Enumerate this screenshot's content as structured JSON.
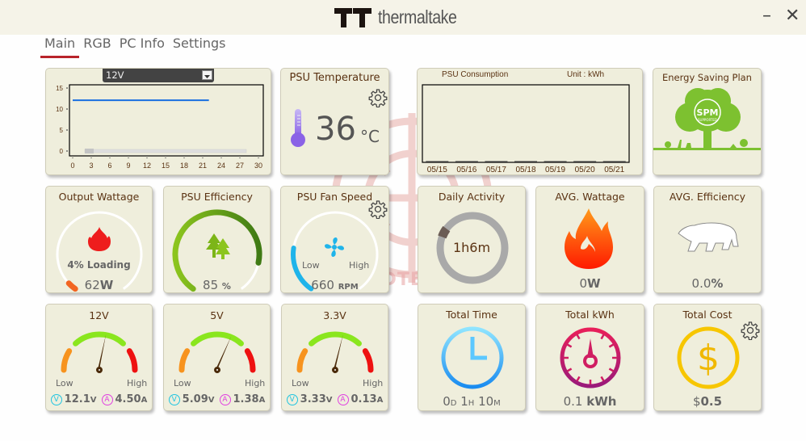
{
  "app": {
    "brand": "thermaltake",
    "minimize_label": "–",
    "close_label": "✕"
  },
  "tabs": [
    {
      "label": "Main",
      "active": true
    },
    {
      "label": "RGB",
      "active": false
    },
    {
      "label": "PC Info",
      "active": false
    },
    {
      "label": "Settings",
      "active": false
    }
  ],
  "voltage_chart": {
    "selected_rail": "12V",
    "chart_data": {
      "type": "line",
      "title": "",
      "xlabel": "",
      "ylabel": "",
      "x_ticks": [
        "0",
        "3",
        "6",
        "9",
        "12",
        "15",
        "18",
        "21",
        "24",
        "27",
        "30"
      ],
      "y_ticks": [
        "0",
        "5",
        "10",
        "15"
      ],
      "xlim": [
        0,
        30
      ],
      "ylim": [
        0,
        15
      ],
      "series": [
        {
          "name": "12V",
          "x": [
            0,
            22
          ],
          "y": [
            12.1,
            12.1
          ],
          "color": "#1a6fe0"
        }
      ]
    },
    "scrollbar_position": 0
  },
  "psu_temperature": {
    "title": "PSU Temperature",
    "value": "36",
    "unit": "°C"
  },
  "psu_consumption": {
    "title": "PSU Consumption",
    "unit_label": "Unit : kWh",
    "chart_data": {
      "type": "bar",
      "categories": [
        "05/15",
        "05/16",
        "05/17",
        "05/18",
        "05/19",
        "05/20",
        "05/21"
      ],
      "values": [
        0,
        0,
        0,
        0,
        0,
        0,
        0
      ],
      "ylabel": "kWh"
    }
  },
  "energy_saving": {
    "title": "Energy Saving Plan",
    "badge_main": "SPM",
    "badge_sub": "SUPPORTED"
  },
  "output_wattage": {
    "title": "Output Wattage",
    "loading": "4% Loading",
    "loading_fraction": 0.04,
    "value": "62",
    "unit": "W"
  },
  "psu_efficiency": {
    "title": "PSU Efficiency",
    "value": "85",
    "unit": "%",
    "fraction": 0.85
  },
  "fan_speed": {
    "title": "PSU Fan Speed",
    "low_label": "Low",
    "high_label": "High",
    "value": "660",
    "unit": "RPM",
    "fraction": 0.22
  },
  "daily_activity": {
    "title": "Daily Activity",
    "value": "1h6m",
    "fraction": 0.046
  },
  "avg_wattage": {
    "title": "AVG. Wattage",
    "value": "0",
    "unit": "W"
  },
  "avg_efficiency": {
    "title": "AVG. Efficiency",
    "value": "0.0",
    "unit": "%"
  },
  "rails": [
    {
      "title": "12V",
      "low": "Low",
      "high": "High",
      "volts": "12.1",
      "volts_unit": "V",
      "amps": "4.50",
      "amps_unit": "A",
      "needle_deg": 8
    },
    {
      "title": "5V",
      "low": "Low",
      "high": "High",
      "volts": "5.09",
      "volts_unit": "V",
      "amps": "1.38",
      "amps_unit": "A",
      "needle_deg": 20
    },
    {
      "title": "3.3V",
      "low": "Low",
      "high": "High",
      "volts": "3.33",
      "volts_unit": "V",
      "amps": "0.13",
      "amps_unit": "A",
      "needle_deg": 10
    }
  ],
  "volt_icon": "V",
  "amp_icon": "A",
  "total_time": {
    "title": "Total Time",
    "d": "0",
    "d_unit": "D",
    "h": "1",
    "h_unit": "H",
    "m": "10",
    "m_unit": "M"
  },
  "total_kwh": {
    "title": "Total kWh",
    "value": "0.1",
    "unit": "kWh"
  },
  "total_cost": {
    "title": "Total Cost",
    "currency": "$",
    "value": "0.5"
  },
  "watermark": "VMODTECH.COM"
}
